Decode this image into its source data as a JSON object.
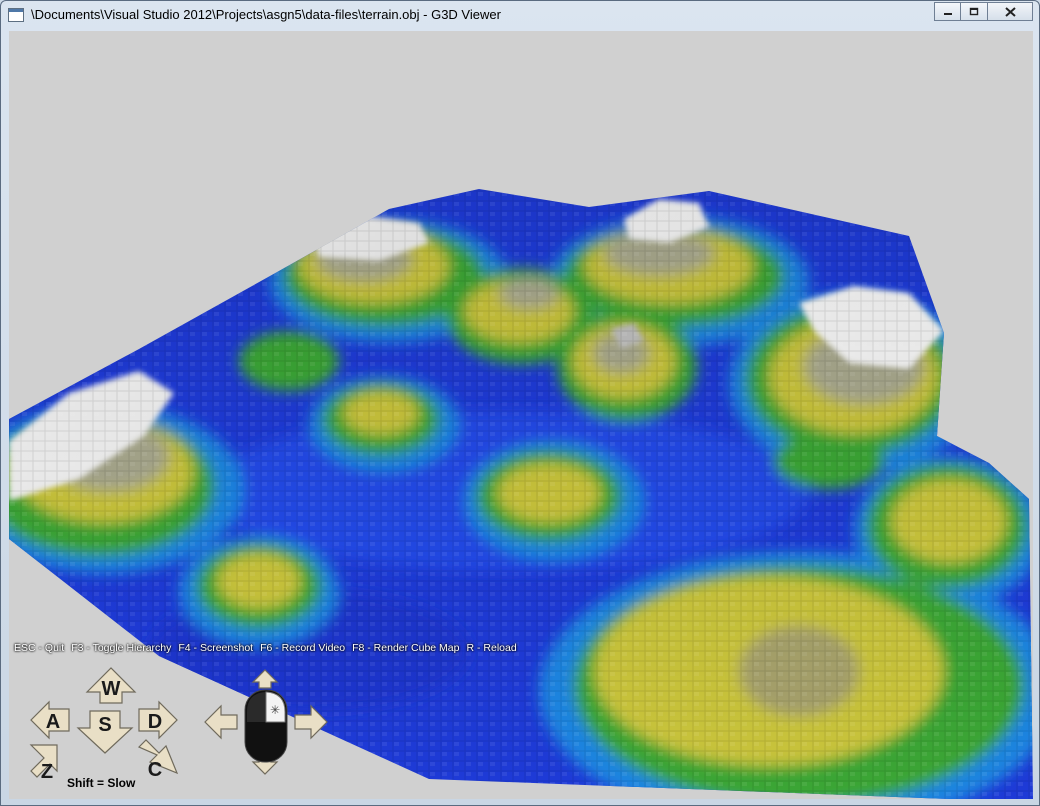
{
  "window": {
    "title": "\\Documents\\Visual Studio 2012\\Projects\\asgn5\\data-files\\terrain.obj - G3D Viewer",
    "controls": {
      "minimize": "minimize",
      "maximize": "maximize",
      "close": "close"
    }
  },
  "help_bar": {
    "items": [
      "ESC - Quit",
      "F3 - Toggle Hierarchy",
      "F4 - Screenshot",
      "F6 - Record Video",
      "F8 - Render Cube Map",
      "R - Reload"
    ]
  },
  "keys": {
    "w": "W",
    "a": "A",
    "s": "S",
    "d": "D",
    "z": "Z",
    "c": "C",
    "shift_hint": "Shift = Slow"
  },
  "colors": {
    "viewport_bg": "#d0d0d0",
    "terrain_blue": "#1f3fd8",
    "terrain_green": "#3fa230",
    "terrain_yellow": "#c9c23a",
    "terrain_gray": "#a8a8a0",
    "terrain_snow": "#f2f2f2",
    "key_fill": "#e9dfc6"
  },
  "icons": [
    "app-icon",
    "minimize-icon",
    "maximize-icon",
    "close-icon",
    "mouse-icon",
    "arrow-icon"
  ]
}
